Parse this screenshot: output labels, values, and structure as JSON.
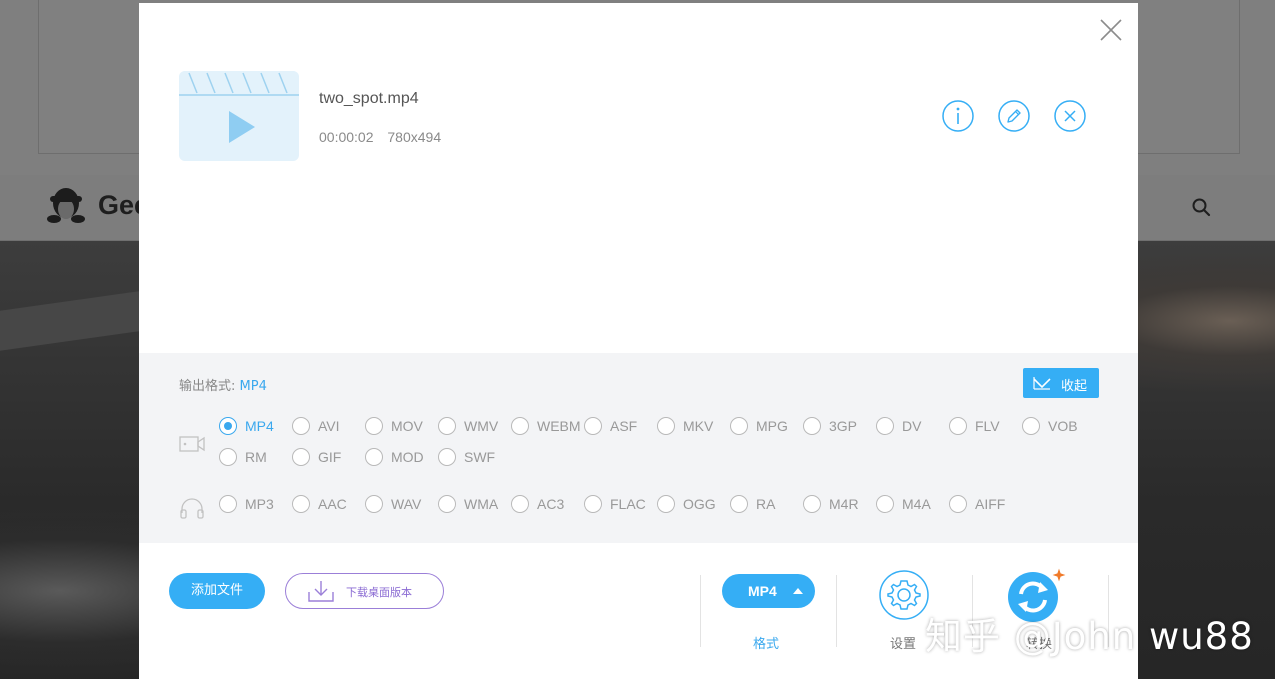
{
  "background": {
    "brand_text": "Gee"
  },
  "file": {
    "name": "two_spot.mp4",
    "duration": "00:00:02",
    "resolution": "780x494"
  },
  "output": {
    "label": "输出格式:",
    "value": "MP4",
    "collapse_label": "收起"
  },
  "video_formats": [
    "MP4",
    "AVI",
    "MOV",
    "WMV",
    "WEBM",
    "ASF",
    "MKV",
    "MPG",
    "3GP",
    "DV",
    "FLV",
    "VOB",
    "RM",
    "GIF",
    "MOD",
    "SWF"
  ],
  "audio_formats": [
    "MP3",
    "AAC",
    "WAV",
    "WMA",
    "AC3",
    "FLAC",
    "OGG",
    "RA",
    "M4R",
    "M4A",
    "AIFF"
  ],
  "selected_format": "MP4",
  "bottom": {
    "add_file_label": "添加文件",
    "download_label": "下载桌面版本",
    "format_select_value": "MP4",
    "format_caption": "格式",
    "settings_caption": "设置",
    "convert_caption": "转换"
  },
  "watermark": "知乎 @John wu88",
  "colors": {
    "accent": "#35aef5",
    "download_border": "#9b7fd8",
    "spark": "#f07a2a"
  }
}
